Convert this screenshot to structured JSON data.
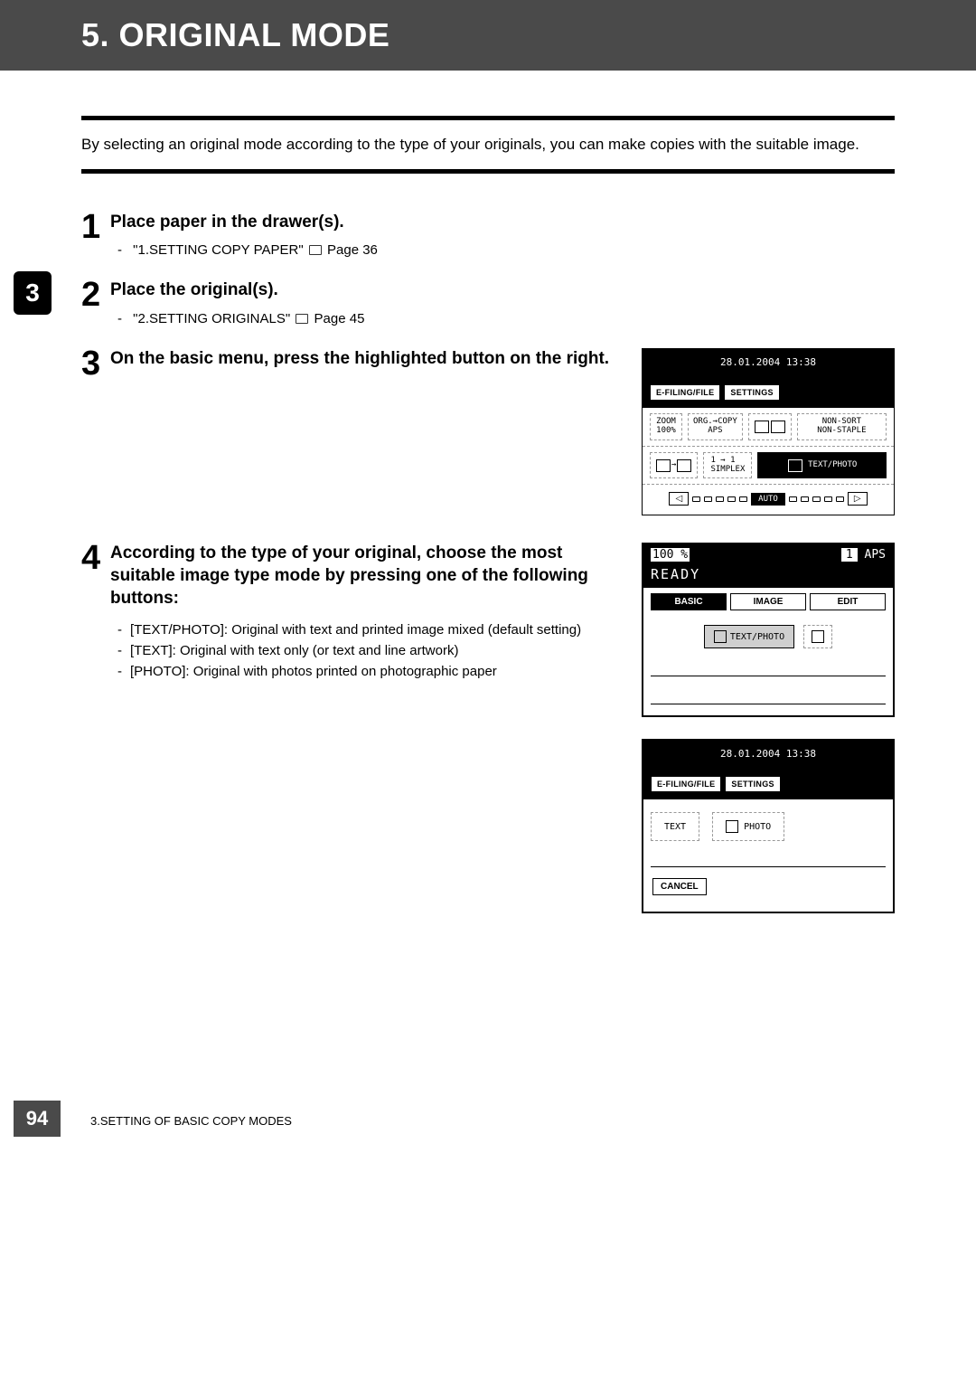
{
  "title": "5. ORIGINAL MODE",
  "intro": "By selecting an original mode according to the type of your originals, you can make copies with the suitable image.",
  "chapter_tab": "3",
  "steps": {
    "s1": {
      "num": "1",
      "title": "Place paper in the drawer(s).",
      "ref": "\"1.SETTING COPY PAPER\"",
      "page": "Page 36"
    },
    "s2": {
      "num": "2",
      "title": "Place the original(s).",
      "ref": "\"2.SETTING ORIGINALS\"",
      "page": "Page 45"
    },
    "s3": {
      "num": "3",
      "title": "On the basic menu, press the highlighted button on the right."
    },
    "s4": {
      "num": "4",
      "title": "According to the type of your original, choose the most suitable image type mode by pressing one of the following buttons:",
      "bullets": {
        "b1": "[TEXT/PHOTO]: Original with text and printed image mixed (default setting)",
        "b2": "[TEXT]: Original with text only (or text and line artwork)",
        "b3": "[PHOTO]: Original with photos printed on photographic paper"
      }
    }
  },
  "panel1": {
    "datetime": "28.01.2004 13:38",
    "tab_efile": "E-FILING/FILE",
    "tab_settings": "SETTINGS",
    "zoom_label": "ZOOM",
    "zoom_val": "100%",
    "org_copy": "ORG.→COPY",
    "aps": "APS",
    "nonsort": "NON-SORT",
    "nonstaple": "NON-STAPLE",
    "simplex": "1 → 1\nSIMPLEX",
    "textphoto": "TEXT/PHOTO",
    "auto": "AUTO"
  },
  "panel2": {
    "zoom": "100 %",
    "count": "1",
    "aps": "APS",
    "ready": "READY",
    "tab_basic": "BASIC",
    "tab_image": "IMAGE",
    "tab_edit": "EDIT",
    "opt_textphoto": "TEXT/PHOTO"
  },
  "panel3": {
    "datetime": "28.01.2004 13:38",
    "tab_efile": "E-FILING/FILE",
    "tab_settings": "SETTINGS",
    "opt_text": "TEXT",
    "opt_photo": "PHOTO",
    "cancel": "CANCEL"
  },
  "footer": {
    "page_num": "94",
    "chapter": "3.SETTING OF BASIC COPY MODES"
  }
}
